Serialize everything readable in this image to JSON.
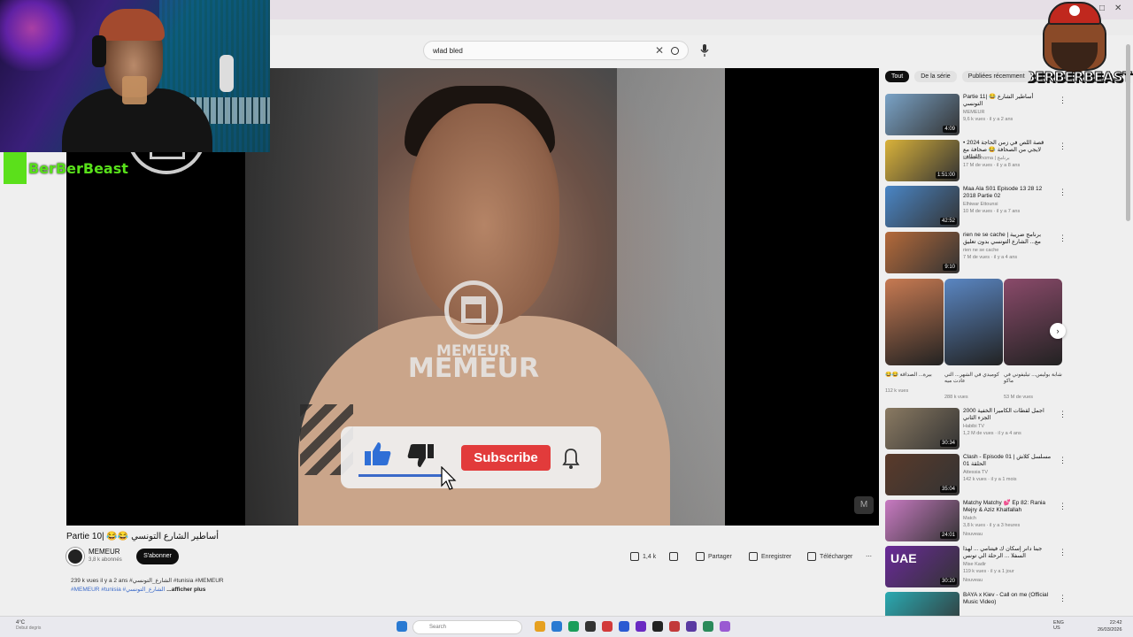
{
  "window": {
    "controls": [
      "–",
      "□",
      "✕"
    ]
  },
  "search": {
    "query": "wlad bled"
  },
  "overlay": {
    "streamer_tag": "BerBerBeast",
    "logo_text": "BERBERBEAST"
  },
  "video": {
    "watermark_top": "MEMEUR",
    "watermark_bottom": "MEMEUR",
    "subscribe_label": "Subscribe",
    "title": "Partie 10| 😂😂 أساطير الشارع التونسي",
    "channel": "MEMEUR",
    "channel_subs": "3,8 k abonnés",
    "subscribe_button": "S'abonner",
    "likes": "1,4 k",
    "share": "Partager",
    "save": "Enregistrer",
    "download": "Télécharger",
    "more": "⋯",
    "desc_line1": "239 k vues  il y a 2 ans  #الشارع_التونسي #tunisia #MEMEUR",
    "desc_line2_tags": "#MEMEUR #tunisia #الشارع_التونسي",
    "desc_more": "...afficher plus"
  },
  "sidebar": {
    "chips": [
      "Tout",
      "De la série",
      "Publiées récemment"
    ],
    "cards_top": [
      {
        "title": "Partie 11| 😂 أساطير الشارع التونسي",
        "channel": "MEMEUR",
        "meta": "9,6 k vues · il y a 2 ans",
        "duration": "4:09",
        "color": "#7aa3c7"
      },
      {
        "title": "قصة اللص في زمن الحاجة 2024 • لايجي من الصحافة 😂 صحافة مع اللطاف",
        "channel": "Dhoof Dhoma | برنامج",
        "meta": "17 M de vues · il y a 8 ans",
        "duration": "1:51:00",
        "color": "#d9b23a"
      },
      {
        "title": "Maa Ala S01 Episode 13 28 12 2018 Partie 02",
        "channel": "Elhiwar Ettounsi",
        "meta": "10 M de vues · il y a 7 ans",
        "duration": "42:52",
        "color": "#4a86c6"
      },
      {
        "title": "rien ne se cache | برنامج ضريبة مع... الشارع التونسي بدون تعليق",
        "channel": "rien ne se cache",
        "meta": "7 M de vues · il y a 4 ans",
        "duration": "9:10",
        "color": "#b56a3a"
      }
    ],
    "shorts": [
      {
        "title": "😂😂 بيرة... الصداقة",
        "views": "112 k vues",
        "color": "#c77a52"
      },
      {
        "title": "كوميدي في الشهر... التي عادت ميه",
        "views": "288 k vues",
        "color": "#5a86c2"
      },
      {
        "title": "شابة بوليس... تيليفوني في ماكو",
        "views": "53 M de vues",
        "color": "#8a4a6a"
      }
    ],
    "cards_bottom": [
      {
        "title": "اجمل لقطات الكاميرا الخفية 2000 الجزء الثاني",
        "channel": "Habibi TV",
        "meta": "1,2 M de vues · il y a 4 ans",
        "duration": "30:34",
        "color": "#8a7a62",
        "badge": ""
      },
      {
        "title": "Clash - Episode 01 | مسلسل كلاش الحلقة 01",
        "channel": "Attessia TV",
        "meta": "142 k vues · il y a 1 mois",
        "duration": "35:04",
        "color": "#5a3a2a",
        "badge": ""
      },
      {
        "title": "Matchy Matchy 💕 Ep 82: Rania Mejry & Aziz Khalfallah",
        "channel": "Match",
        "meta": "3,8 k vues · il y a 3 heures",
        "duration": "24:01",
        "color": "#c87ac2",
        "badge": "Nouveau"
      },
      {
        "title": "جبنا دانر إسكان ك فيتنامي ... لهذا السفلا ... الرحلة الي تونس",
        "channel": "Mise Kadir",
        "meta": "119 k vues · il y a 1 jour",
        "duration": "30:20",
        "color": "#6a2a9a",
        "badge": "Nouveau",
        "thumb_text": "UAE"
      },
      {
        "title": "BAYA x Kiev - Call on me (Official Music Video)",
        "channel": "",
        "meta": "",
        "duration": "",
        "color": "#2aaab2",
        "badge": ""
      }
    ]
  },
  "taskbar": {
    "weather": "4°C",
    "weather_sub": "Debut degris",
    "search": "Search",
    "lang": "ENG",
    "lang_sub": "US",
    "time": "22:42",
    "date": "26/03/2026",
    "app_colors": [
      "#e6a020",
      "#2a7ad2",
      "#1a9e5a",
      "#333333",
      "#d23a3a",
      "#2a5ad2",
      "#6a2ac2",
      "#222222",
      "#c23a3a",
      "#5a3aa2",
      "#2a8a5a",
      "#9a5ad2"
    ]
  }
}
